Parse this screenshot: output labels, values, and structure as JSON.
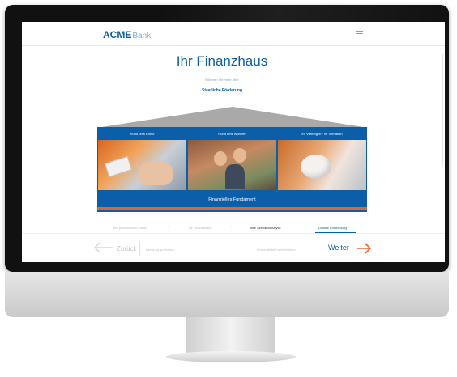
{
  "header": {
    "logo_main": "ACME",
    "logo_sub": "Bank"
  },
  "hero": {
    "title": "Ihr Finanzhaus",
    "subtitle": "Erfahren Sie mehr über",
    "link": "Staatliche Förderung"
  },
  "house": {
    "pillars": [
      {
        "label": "Rund ums Konto"
      },
      {
        "label": "Rund ums Wohnen"
      },
      {
        "label": "Ihr Vermögen / Ihr Vorhaben"
      }
    ],
    "foundation_label": "Finanzielles Fundament"
  },
  "stepper": {
    "steps": [
      {
        "label": "Ihre persönlichen Daten",
        "state": "pending"
      },
      {
        "label": "Ihr Finanzstatus",
        "state": "pending"
      },
      {
        "label": "Ihre Szenarioanalyse",
        "state": "done"
      },
      {
        "label": "Unsere Empfehlung",
        "state": "active"
      }
    ]
  },
  "nav": {
    "back_label": "Zurück",
    "save_label": "Beratung speichern ...",
    "proceed_label": "Geschäftsfeld weiterführen ...",
    "next_label": "Weiter"
  },
  "colors": {
    "brand_blue": "#0b5fa8",
    "accent_orange": "#e6632b",
    "roof_gray": "#a9a9a9"
  }
}
